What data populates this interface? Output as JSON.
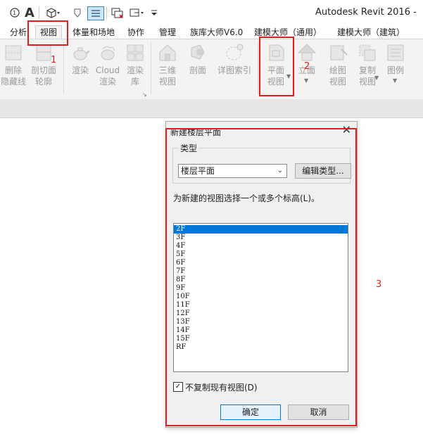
{
  "app": {
    "title": "Autodesk Revit 2016 -"
  },
  "quick_access": {
    "icons": [
      "sync-icon",
      "text-icon",
      "3d-box-icon",
      "tag-icon",
      "thin-lines-icon",
      "switch-windows-icon",
      "close-windows-icon",
      "customize-icon"
    ],
    "glyphs": {
      "text": "A"
    }
  },
  "tabs": [
    {
      "label": "分析"
    },
    {
      "label": "视图",
      "active": true
    },
    {
      "label": "体量和场地"
    },
    {
      "label": "协作"
    },
    {
      "label": "管理"
    },
    {
      "label": "族库大师V6.0"
    },
    {
      "label": "建模大师（通用）"
    },
    {
      "label": "建模大师（建筑）"
    }
  ],
  "ribbon": {
    "buttons": [
      {
        "id": "delete-hidden-lines",
        "lines": [
          "删除",
          "隐藏线"
        ]
      },
      {
        "id": "cut-profile",
        "lines": [
          "剖切面",
          "轮廓"
        ]
      },
      {
        "id": "render",
        "lines": [
          "渲染",
          ""
        ]
      },
      {
        "id": "cloud-render",
        "lines": [
          "Cloud",
          "渲染"
        ]
      },
      {
        "id": "render-gallery",
        "lines": [
          "渲染",
          "库"
        ]
      },
      {
        "id": "3d-view",
        "lines": [
          "三维",
          "视图"
        ]
      },
      {
        "id": "section",
        "lines": [
          "剖面",
          ""
        ]
      },
      {
        "id": "callout",
        "lines": [
          "详图索引",
          ""
        ]
      },
      {
        "id": "plan-views",
        "lines": [
          "平面",
          "视图"
        ]
      },
      {
        "id": "elevation",
        "lines": [
          "立面",
          ""
        ]
      },
      {
        "id": "drafting-view",
        "lines": [
          "绘图",
          "视图"
        ]
      },
      {
        "id": "duplicate-view",
        "lines": [
          "复制",
          "视图"
        ]
      },
      {
        "id": "legends",
        "lines": [
          "图例",
          ""
        ]
      }
    ]
  },
  "dialog": {
    "title": "新建楼层平面",
    "type_group_label": "类型",
    "type_value": "楼层平面",
    "edit_type_label": "编辑类型...",
    "instruction": "为新建的视图选择一个或多个标高(L)。",
    "levels": [
      "2F",
      "3F",
      "4F",
      "5F",
      "6F",
      "7F",
      "8F",
      "9F",
      "10F",
      "11F",
      "12F",
      "13F",
      "14F",
      "15F",
      "RF"
    ],
    "selected_level": "2F",
    "dont_duplicate_label": "不复制现有视图(D)",
    "dont_duplicate_checked": true,
    "ok_label": "确定",
    "cancel_label": "取消"
  },
  "annotations": {
    "labels": [
      "1",
      "2",
      "3"
    ],
    "color": "#e31c1c"
  },
  "colors": {
    "selection": "#0078d7",
    "ribbon_bg": "#f3f3f3",
    "dialog_bg": "#f0f0f0"
  }
}
